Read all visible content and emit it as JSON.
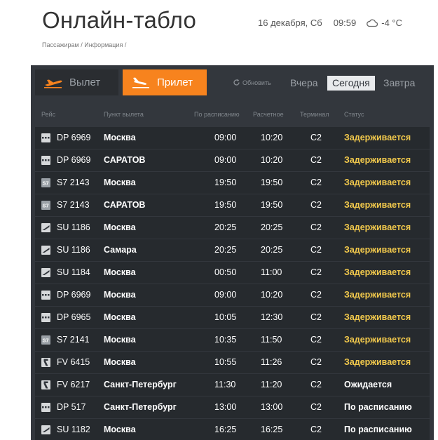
{
  "header": {
    "title": "Онлайн-табло",
    "date": "16 декабря, Сб",
    "time": "09:59",
    "temperature": "-4 °C",
    "weather_icon": "cloud-icon",
    "breadcrumb": "Пассажирам / Информация /"
  },
  "tabs": {
    "departure": "Вылет",
    "arrival": "Прилет",
    "active": "arrival"
  },
  "controls": {
    "refresh": "Обновить",
    "yesterday": "Вчера",
    "today": "Сегодня",
    "tomorrow": "Завтра",
    "active_day": "today"
  },
  "columns": {
    "flight": "Рейс",
    "origin": "Пункт вылета",
    "scheduled": "По расписанию",
    "estimated": "Расчетное",
    "terminal": "Терминал",
    "status": "Статус"
  },
  "colors": {
    "accent": "#f7831e",
    "board": "#33373d",
    "row": "#262a2e",
    "delayed": "#f2c94c"
  },
  "flights": [
    {
      "airline": "DP",
      "flight": "DP 6969",
      "city": "Москва",
      "scheduled": "09:00",
      "estimated": "10:20",
      "terminal": "C2",
      "status": "Задерживается",
      "delayed": true
    },
    {
      "airline": "DP",
      "flight": "DP 6969",
      "city": "САРАТОВ",
      "scheduled": "09:00",
      "estimated": "10:20",
      "terminal": "C2",
      "status": "Задерживается",
      "delayed": true
    },
    {
      "airline": "S7",
      "flight": "S7 2143",
      "city": "Москва",
      "scheduled": "19:50",
      "estimated": "19:50",
      "terminal": "C2",
      "status": "Задерживается",
      "delayed": true
    },
    {
      "airline": "S7",
      "flight": "S7 2143",
      "city": "САРАТОВ",
      "scheduled": "19:50",
      "estimated": "19:50",
      "terminal": "C2",
      "status": "Задерживается",
      "delayed": true
    },
    {
      "airline": "SU",
      "flight": "SU 1186",
      "city": "Москва",
      "scheduled": "20:25",
      "estimated": "20:25",
      "terminal": "C2",
      "status": "Задерживается",
      "delayed": true
    },
    {
      "airline": "SU",
      "flight": "SU 1186",
      "city": "Самара",
      "scheduled": "20:25",
      "estimated": "20:25",
      "terminal": "C2",
      "status": "Задерживается",
      "delayed": true
    },
    {
      "airline": "SU",
      "flight": "SU 1184",
      "city": "Москва",
      "scheduled": "00:50",
      "estimated": "11:00",
      "terminal": "C2",
      "status": "Задерживается",
      "delayed": true
    },
    {
      "airline": "DP",
      "flight": "DP 6969",
      "city": "Москва",
      "scheduled": "09:00",
      "estimated": "10:20",
      "terminal": "C2",
      "status": "Задерживается",
      "delayed": true
    },
    {
      "airline": "DP",
      "flight": "DP 6965",
      "city": "Москва",
      "scheduled": "10:05",
      "estimated": "12:30",
      "terminal": "C2",
      "status": "Задерживается",
      "delayed": true
    },
    {
      "airline": "S7",
      "flight": "S7 2141",
      "city": "Москва",
      "scheduled": "10:35",
      "estimated": "11:50",
      "terminal": "C2",
      "status": "Задерживается",
      "delayed": true
    },
    {
      "airline": "FV",
      "flight": "FV 6415",
      "city": "Москва",
      "scheduled": "10:55",
      "estimated": "11:26",
      "terminal": "C2",
      "status": "Задерживается",
      "delayed": true
    },
    {
      "airline": "FV",
      "flight": "FV 6217",
      "city": "Санкт-Петербург",
      "scheduled": "11:30",
      "estimated": "11:20",
      "terminal": "C2",
      "status": "Ожидается",
      "delayed": false
    },
    {
      "airline": "DP",
      "flight": "DP 517",
      "city": "Санкт-Петербург",
      "scheduled": "13:00",
      "estimated": "13:00",
      "terminal": "C2",
      "status": "По расписанию",
      "delayed": false
    },
    {
      "airline": "SU",
      "flight": "SU 1182",
      "city": "Москва",
      "scheduled": "16:25",
      "estimated": "16:25",
      "terminal": "C2",
      "status": "По расписанию",
      "delayed": false
    }
  ]
}
